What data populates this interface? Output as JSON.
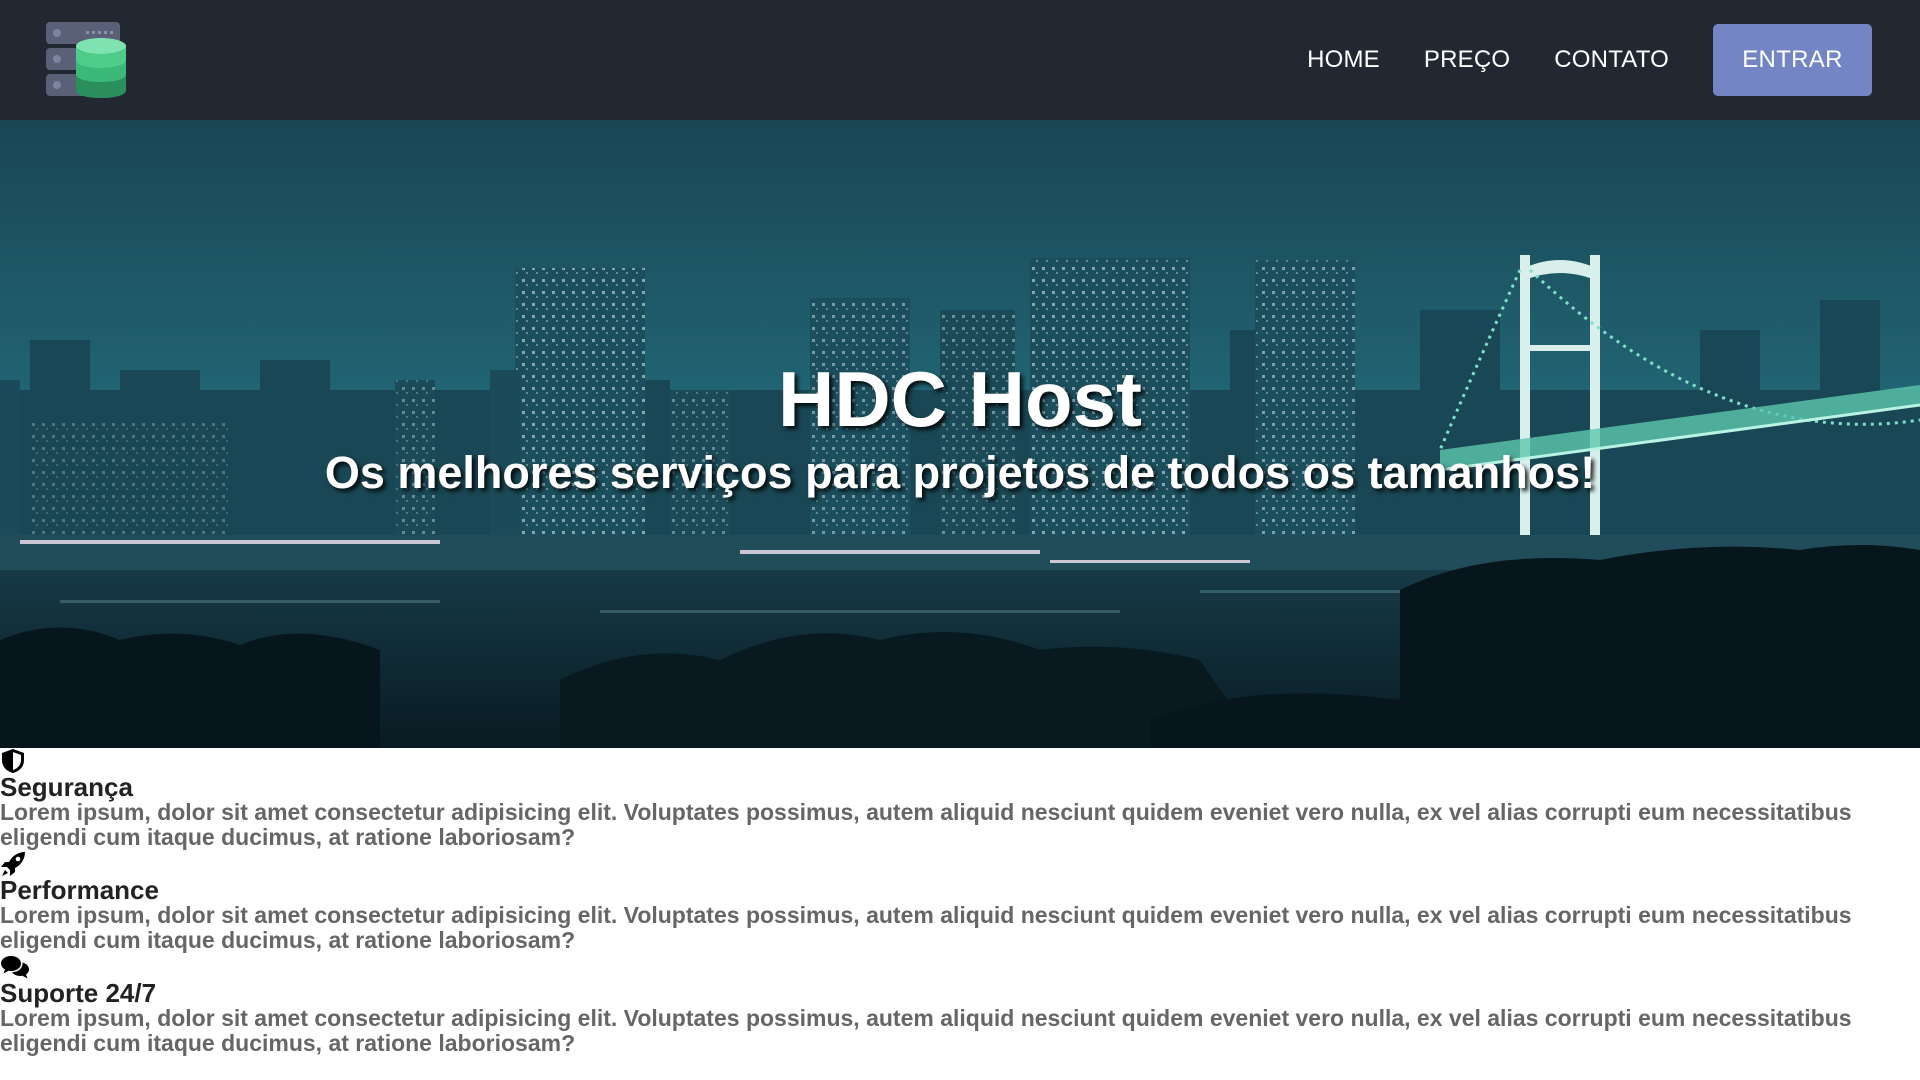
{
  "brand": {
    "logo_icon": "database-server-icon",
    "colors": {
      "navbar_bg": "#222831",
      "accent": "#7385c4",
      "logo_green": "#3cb878",
      "logo_server": "#5a6078"
    }
  },
  "nav": {
    "links": [
      {
        "label": "HOME"
      },
      {
        "label": "PREÇO"
      },
      {
        "label": "CONTATO"
      }
    ],
    "enter_label": "ENTRAR"
  },
  "hero": {
    "title": "HDC Host",
    "subtitle": "Os melhores serviços para projetos de todos os tamanhos!",
    "background": "night-city-skyline-with-bridge"
  },
  "features": [
    {
      "icon": "shield-icon",
      "title": "Segurança",
      "text": "Lorem ipsum, dolor sit amet consectetur adipisicing elit. Voluptates possimus, autem aliquid nesciunt quidem eveniet vero nulla, ex vel alias corrupti eum necessitatibus eligendi cum itaque ducimus, at ratione laboriosam?"
    },
    {
      "icon": "rocket-icon",
      "title": "Performance",
      "text": "Lorem ipsum, dolor sit amet consectetur adipisicing elit. Voluptates possimus, autem aliquid nesciunt quidem eveniet vero nulla, ex vel alias corrupti eum necessitatibus eligendi cum itaque ducimus, at ratione laboriosam?"
    },
    {
      "icon": "chat-bubbles-icon",
      "title": "Suporte 24/7",
      "text": "Lorem ipsum, dolor sit amet consectetur adipisicing elit. Voluptates possimus, autem aliquid nesciunt quidem eveniet vero nulla, ex vel alias corrupti eum necessitatibus eligendi cum itaque ducimus, at ratione laboriosam?"
    }
  ]
}
